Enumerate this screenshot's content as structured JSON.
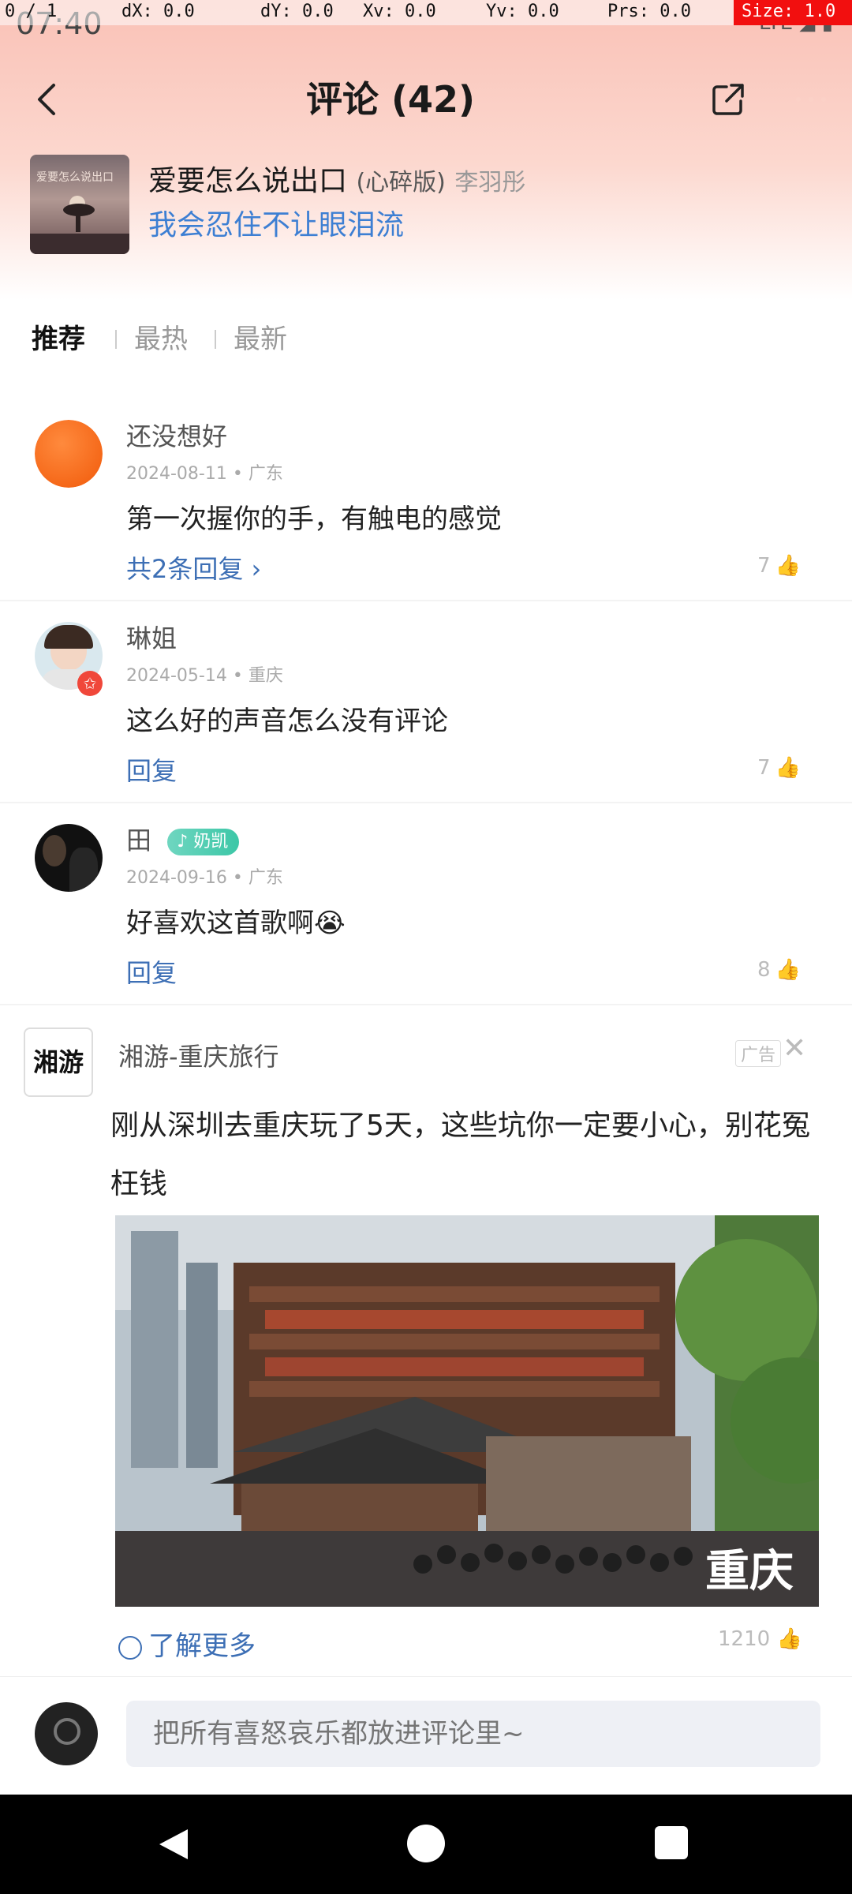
{
  "status": {
    "time": "07:40",
    "network": "LTE"
  },
  "debug": {
    "pointer": "0 / 1",
    "dx": "dX: 0.0",
    "dy": "dY: 0.0",
    "xv": "Xv: 0.0",
    "yv": "Yv: 0.0",
    "prs": "Prs: 0.0",
    "size": "Size: 1.0"
  },
  "header": {
    "title": "评论 (42)",
    "back_icon": "chevron-left-icon",
    "share_icon": "share-external-icon",
    "more_icon": "more-icon"
  },
  "song": {
    "title": "爱要怎么说出口",
    "version": "(心碎版)",
    "artist": "李羽彤",
    "lyric": "我会忍住不让眼泪流",
    "cover_text": "爱要怎么说出口"
  },
  "tabs": [
    {
      "label": "推荐",
      "active": true
    },
    {
      "label": "最热",
      "active": false
    },
    {
      "label": "最新",
      "active": false
    }
  ],
  "comments": [
    {
      "name": "还没想好",
      "meta": "2024-08-11 • 广东",
      "text": "第一次握你的手，有触电的感觉",
      "reply": "共2条回复 ›",
      "like_count": "7"
    },
    {
      "name": "琳姐",
      "meta": "2024-05-14 • 重庆",
      "text": "这么好的声音怎么没有评论",
      "reply": "回复",
      "like_count": "7"
    },
    {
      "name": "田",
      "badge": "奶凯",
      "meta": "2024-09-16 • 广东",
      "text": "好喜欢这首歌啊😭",
      "reply": "回复",
      "like_count": "8"
    }
  ],
  "ad": {
    "logo_text": "湘游",
    "name": "湘游-重庆旅行",
    "label": "广告",
    "text": "刚从深圳去重庆玩了5天，这些坑你一定要小心，别花冤枉钱",
    "image_caption": "重庆",
    "more": "了解更多",
    "like_count": "1210"
  },
  "input": {
    "placeholder": "把所有喜怒哀乐都放进评论里~"
  }
}
